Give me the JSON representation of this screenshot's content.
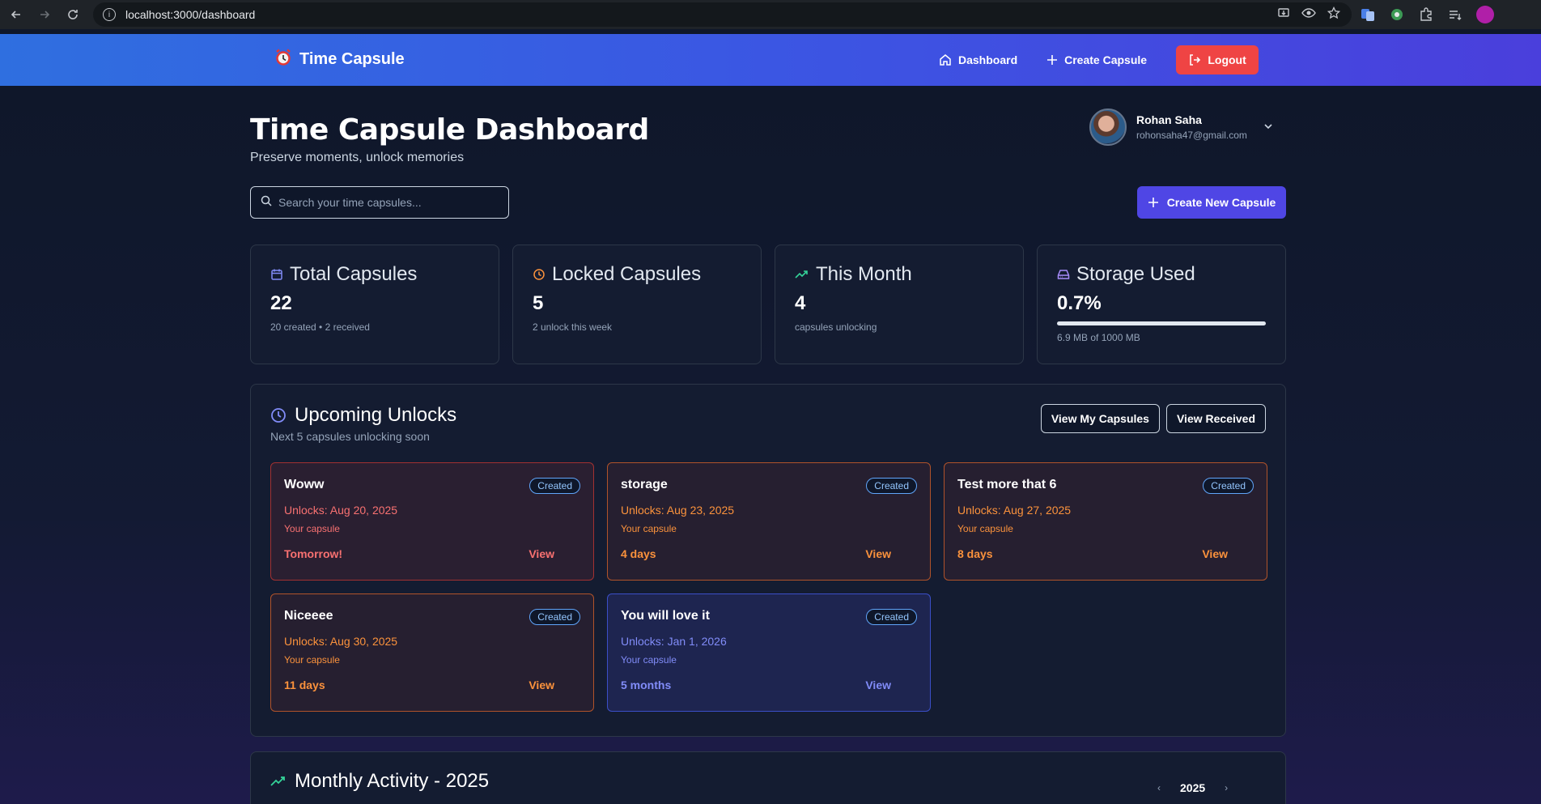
{
  "browser": {
    "url": "localhost:3000/dashboard"
  },
  "header": {
    "brand": "Time Capsule",
    "nav": {
      "dashboard": "Dashboard",
      "create": "Create Capsule",
      "logout": "Logout"
    }
  },
  "page": {
    "title": "Time Capsule Dashboard",
    "subtitle": "Preserve moments, unlock memories"
  },
  "user": {
    "name": "Rohan Saha",
    "email": "rohonsaha47@gmail.com"
  },
  "search": {
    "placeholder": "Search your time capsules..."
  },
  "create_button": "Create New Capsule",
  "stats": [
    {
      "label": "Total Capsules",
      "value": "22",
      "sub": "20 created • 2 received",
      "icon": "calendar-icon"
    },
    {
      "label": "Locked Capsules",
      "value": "5",
      "sub": "2 unlock this week",
      "icon": "clock-icon"
    },
    {
      "label": "This Month",
      "value": "4",
      "sub": "capsules unlocking",
      "icon": "trending-up-icon"
    },
    {
      "label": "Storage Used",
      "value": "0.7%",
      "sub": "6.9 MB of 1000 MB",
      "icon": "hard-drive-icon",
      "progress_fraction": 0.007
    }
  ],
  "upcoming": {
    "title": "Upcoming Unlocks",
    "subtitle": "Next 5 capsules unlocking soon",
    "view_mine": "View My Capsules",
    "view_received": "View Received",
    "capsules": [
      {
        "name": "Woww",
        "badge": "Created",
        "unlocks": "Unlocks: Aug 20, 2025",
        "owner": "Your capsule",
        "countdown": "Tomorrow!",
        "view": "View",
        "tone": "red"
      },
      {
        "name": "storage",
        "badge": "Created",
        "unlocks": "Unlocks: Aug 23, 2025",
        "owner": "Your capsule",
        "countdown": "4 days",
        "view": "View",
        "tone": "orange"
      },
      {
        "name": "Test more that 6",
        "badge": "Created",
        "unlocks": "Unlocks: Aug 27, 2025",
        "owner": "Your capsule",
        "countdown": "8 days",
        "view": "View",
        "tone": "orange"
      },
      {
        "name": "Niceeee",
        "badge": "Created",
        "unlocks": "Unlocks: Aug 30, 2025",
        "owner": "Your capsule",
        "countdown": "11 days",
        "view": "View",
        "tone": "orange"
      },
      {
        "name": "You will love it",
        "badge": "Created",
        "unlocks": "Unlocks: Jan 1, 2026",
        "owner": "Your capsule",
        "countdown": "5 months",
        "view": "View",
        "tone": "blue"
      }
    ]
  },
  "monthly": {
    "title": "Monthly Activity - 2025",
    "year": "2025",
    "prev": "‹",
    "next": "›"
  },
  "colors": {
    "header_start": "#2f6fe0",
    "header_end": "#4a3fdc",
    "logout": "#ef4444",
    "primary": "#4f46e5"
  }
}
